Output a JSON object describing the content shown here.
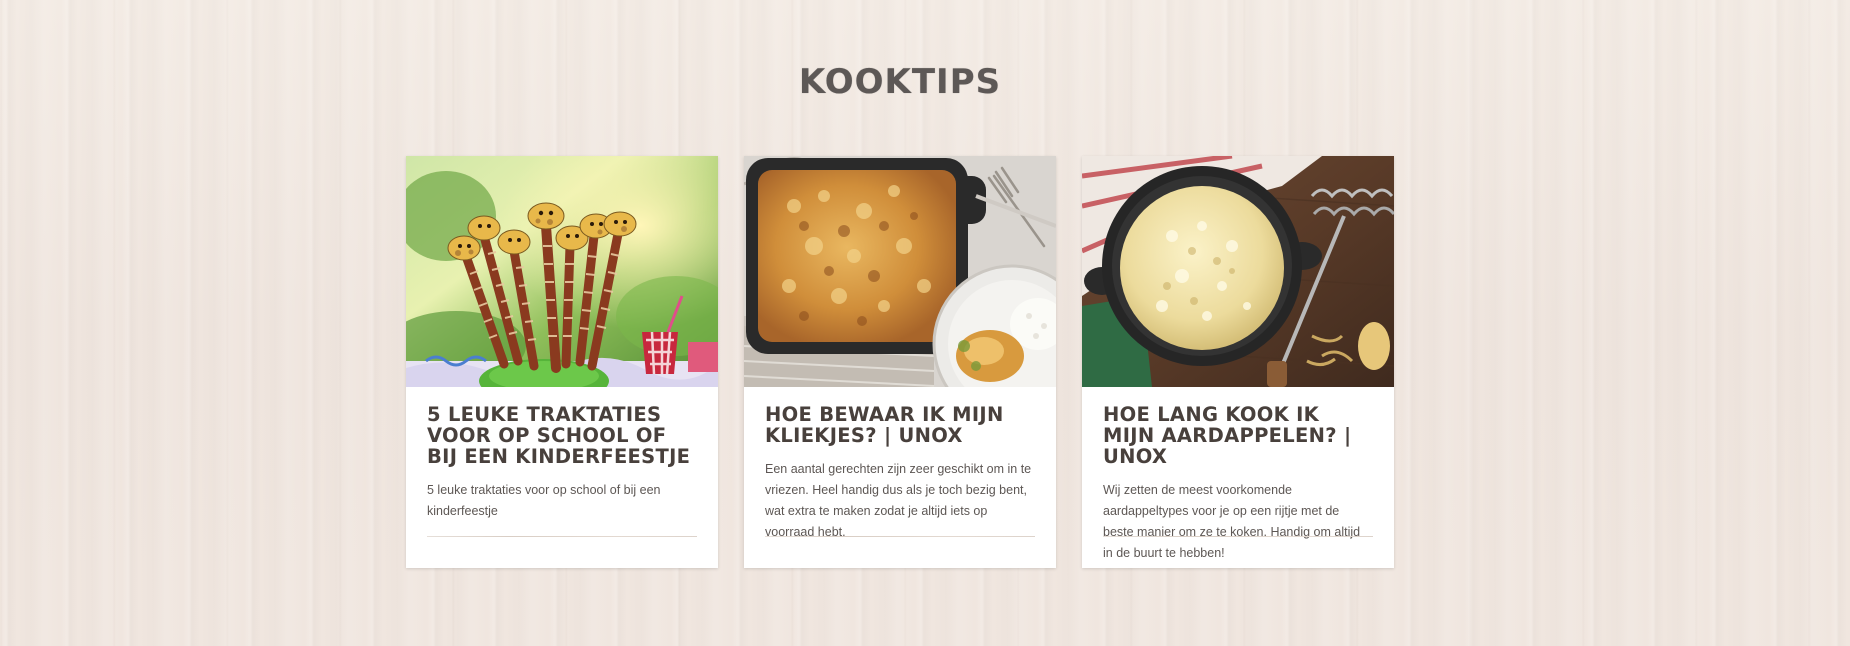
{
  "section": {
    "title": "KOOKTIPS"
  },
  "cards": [
    {
      "title": "5 LEUKE TRAKTATIES VOOR OP SCHOOL OF BIJ EEN KINDERFEESTJE",
      "description": "5 leuke traktaties voor op school of bij een kinderfeestje",
      "image": "giraffe-sausage-treats-photo"
    },
    {
      "title": "HOE BEWAAR IK MIJN KLIEKJES? | UNOX",
      "description": "Een aantal gerechten zijn zeer geschikt om in te vriezen. Heel handig dus als je toch bezig bent, wat extra te maken zodat je altijd iets op voorraad hebt.",
      "image": "casserole-dish-photo"
    },
    {
      "title": "HOE LANG KOOK IK MIJN AARDAPPELEN? | UNOX",
      "description": "Wij zetten de meest voorkomende aardappeltypes voor je op een rijtje met de beste manier om ze te koken. Handig om altijd in de buurt te hebben!",
      "image": "mashed-potatoes-pot-photo"
    }
  ]
}
